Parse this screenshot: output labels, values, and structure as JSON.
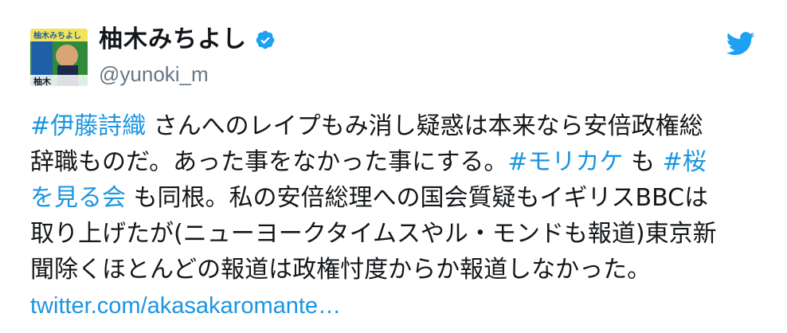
{
  "user": {
    "display_name": "柚木みちよし",
    "handle": "@yunoki_m",
    "avatar_poster_text": "柚木みちよし",
    "avatar_name_text": "柚木",
    "verified_icon": "verified-badge-icon",
    "brand_icon": "twitter-bird-icon"
  },
  "tweet": {
    "line1": {
      "hashtag": "#伊藤詩織",
      "rest": " さんへのレイプもみ消し疑惑は本来なら安倍政権総"
    },
    "line2": {
      "text": "辞職ものだ。あった事をなかった事にする。",
      "hashtag1": "#モリカケ",
      "mid": " も ",
      "hashtag2_part1": "#桜"
    },
    "line3": {
      "hashtag2_part2": "を見る会",
      "rest": " も同根。私の安倍総理への国会質疑もイギリスBBCは"
    },
    "line4": {
      "text": "取り上げたが(ニューヨークタイムスやル・モンドも報道)東京新"
    },
    "line5": {
      "text": "聞除くほとんどの報道は政権忖度からか報道しなかった。"
    },
    "link": "twitter.com/akasakaromante…"
  },
  "colors": {
    "link": "#1b95e0",
    "name": "#14171a",
    "handle": "#657786",
    "verified": "#1da1f2",
    "bird": "#1da1f2"
  }
}
